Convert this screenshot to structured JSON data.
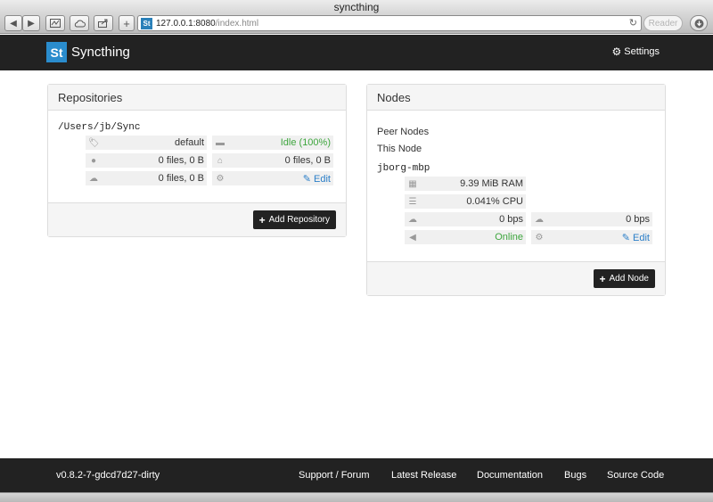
{
  "window": {
    "title": "syncthing"
  },
  "browser": {
    "url_host": "127.0.0.1:8080",
    "url_path": "/index.html",
    "reader_label": "Reader",
    "reload_glyph": "↻"
  },
  "navbar": {
    "logo_text": "St",
    "brand": "Syncthing",
    "settings_label": "Settings"
  },
  "repositories": {
    "heading": "Repositories",
    "items": [
      {
        "path": "/Users/jb/Sync",
        "id": "default",
        "state": "Idle (100%)",
        "local": "0 files, 0 B",
        "global": "0 files, 0 B",
        "need": "0 files, 0 B",
        "edit_label": "Edit"
      }
    ],
    "add_label": "Add Repository"
  },
  "nodes": {
    "heading": "Nodes",
    "peer_label": "Peer Nodes",
    "this_label": "This Node",
    "this_node": {
      "name": "jborg-mbp",
      "ram": "9.39 MiB RAM",
      "cpu": "0.041% CPU",
      "in_rate": "0 bps",
      "out_rate": "0 bps",
      "status": "Online",
      "edit_label": "Edit"
    },
    "add_label": "Add Node"
  },
  "footer": {
    "version": "v0.8.2-7-gdcd7d27-dirty",
    "links": [
      "Support / Forum",
      "Latest Release",
      "Documentation",
      "Bugs",
      "Source Code"
    ]
  },
  "colors": {
    "navbar_bg": "#222222",
    "brand_blue": "#2a8ccd",
    "status_green": "#3ea63e",
    "link_blue": "#2a7ec8"
  },
  "icons": [
    "back-icon",
    "forward-icon",
    "bookmarks-icon",
    "cloud-icon",
    "share-icon",
    "new-tab-icon",
    "reload-icon",
    "download-icon",
    "gear-icon",
    "tag-icon",
    "comment-icon",
    "globe-icon",
    "home-icon",
    "cloud-download-icon",
    "cloud-upload-icon",
    "pencil-icon",
    "plus-icon",
    "memory-icon",
    "cpu-icon",
    "bullhorn-icon"
  ]
}
